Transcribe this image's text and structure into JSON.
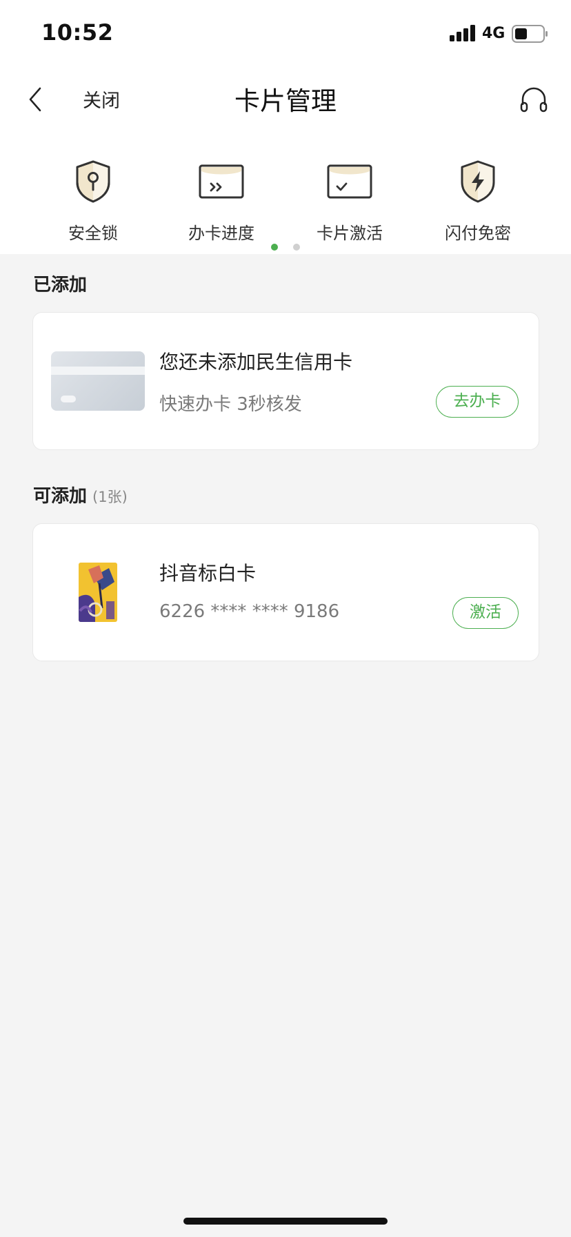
{
  "status_bar": {
    "time": "10:52",
    "network": "4G"
  },
  "nav": {
    "close_label": "关闭",
    "title": "卡片管理"
  },
  "actions": [
    {
      "label": "安全锁",
      "icon": "shield-key-icon"
    },
    {
      "label": "办卡进度",
      "icon": "card-progress-icon"
    },
    {
      "label": "卡片激活",
      "icon": "card-activate-icon"
    },
    {
      "label": "闪付免密",
      "icon": "shield-lightning-icon"
    }
  ],
  "pager": {
    "pages": 2,
    "active": 0
  },
  "added_section": {
    "title": "已添加",
    "card": {
      "title": "您还未添加民生信用卡",
      "subtitle": "快速办卡 3秒核发",
      "button": "去办卡"
    }
  },
  "available_section": {
    "title": "可添加",
    "count": "(1张)",
    "card": {
      "name": "抖音标白卡",
      "number": "6226 **** **** 9186",
      "button": "激活"
    }
  },
  "colors": {
    "accent": "#4caf50",
    "background": "#f4f4f4"
  }
}
